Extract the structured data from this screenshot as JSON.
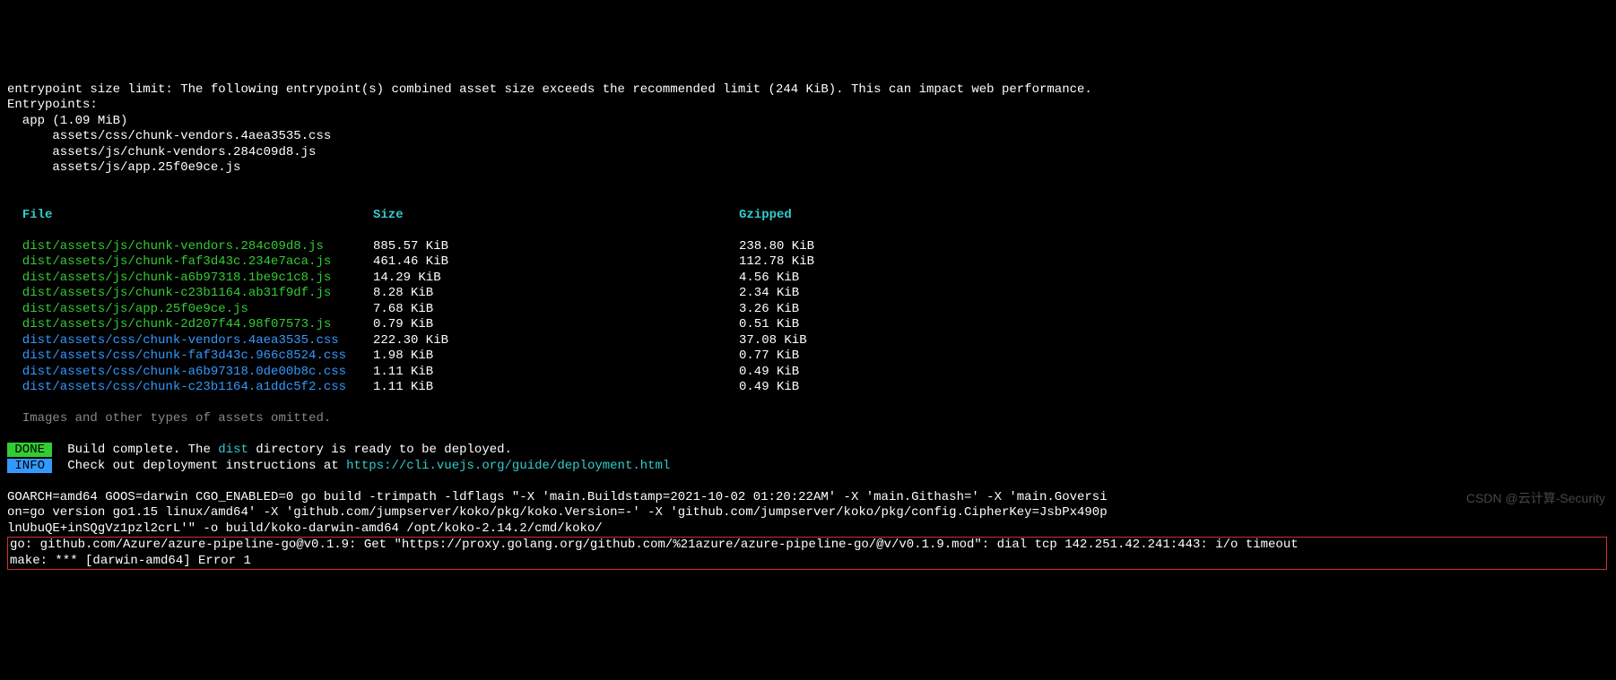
{
  "warning": {
    "line1": "entrypoint size limit: The following entrypoint(s) combined asset size exceeds the recommended limit (244 KiB). This can impact web performance.",
    "line2": "Entrypoints:",
    "line3": "  app (1.09 MiB)",
    "line4": "      assets/css/chunk-vendors.4aea3535.css",
    "line5": "      assets/js/chunk-vendors.284c09d8.js",
    "line6": "      assets/js/app.25f0e9ce.js"
  },
  "headers": {
    "file": "File",
    "size": "Size",
    "gzipped": "Gzipped"
  },
  "rows": [
    {
      "file": "dist/assets/js/chunk-vendors.284c09d8.js",
      "size": "885.57 KiB",
      "gzipped": "238.80 KiB",
      "cls": "green"
    },
    {
      "file": "dist/assets/js/chunk-faf3d43c.234e7aca.js",
      "size": "461.46 KiB",
      "gzipped": "112.78 KiB",
      "cls": "green"
    },
    {
      "file": "dist/assets/js/chunk-a6b97318.1be9c1c8.js",
      "size": "14.29 KiB",
      "gzipped": "4.56 KiB",
      "cls": "green"
    },
    {
      "file": "dist/assets/js/chunk-c23b1164.ab31f9df.js",
      "size": "8.28 KiB",
      "gzipped": "2.34 KiB",
      "cls": "green"
    },
    {
      "file": "dist/assets/js/app.25f0e9ce.js",
      "size": "7.68 KiB",
      "gzipped": "3.26 KiB",
      "cls": "green"
    },
    {
      "file": "dist/assets/js/chunk-2d207f44.98f07573.js",
      "size": "0.79 KiB",
      "gzipped": "0.51 KiB",
      "cls": "green"
    },
    {
      "file": "dist/assets/css/chunk-vendors.4aea3535.css",
      "size": "222.30 KiB",
      "gzipped": "37.08 KiB",
      "cls": "blue"
    },
    {
      "file": "dist/assets/css/chunk-faf3d43c.966c8524.css",
      "size": "1.98 KiB",
      "gzipped": "0.77 KiB",
      "cls": "blue"
    },
    {
      "file": "dist/assets/css/chunk-a6b97318.0de00b8c.css",
      "size": "1.11 KiB",
      "gzipped": "0.49 KiB",
      "cls": "blue"
    },
    {
      "file": "dist/assets/css/chunk-c23b1164.a1ddc5f2.css",
      "size": "1.11 KiB",
      "gzipped": "0.49 KiB",
      "cls": "blue"
    }
  ],
  "omitted": "Images and other types of assets omitted.",
  "done": {
    "badge": " DONE ",
    "t1": "Build complete. The ",
    "dist": "dist",
    "t2": " directory is ready to be deployed."
  },
  "info": {
    "badge": " INFO ",
    "t1": "Check out deployment instructions at ",
    "url": "https://cli.vuejs.org/guide/deployment.html"
  },
  "build": {
    "l1": "GOARCH=amd64 GOOS=darwin CGO_ENABLED=0 go build -trimpath -ldflags \"-X 'main.Buildstamp=2021-10-02 01:20:22AM' -X 'main.Githash=' -X 'main.Goversi",
    "l2": "on=go version go1.15 linux/amd64' -X 'github.com/jumpserver/koko/pkg/koko.Version=-' -X 'github.com/jumpserver/koko/pkg/config.CipherKey=JsbPx490p",
    "l3": "lnUbuQE+inSQgVz1pzl2crL'\" -o build/koko-darwin-amd64 /opt/koko-2.14.2/cmd/koko/"
  },
  "error": {
    "l1": "go: github.com/Azure/azure-pipeline-go@v0.1.9: Get \"https://proxy.golang.org/github.com/%21azure/azure-pipeline-go/@v/v0.1.9.mod\": dial tcp 142.251.42.241:443: i/o timeout",
    "l2": "make: *** [darwin-amd64] Error 1"
  },
  "watermark": "CSDN @云计算-Security"
}
